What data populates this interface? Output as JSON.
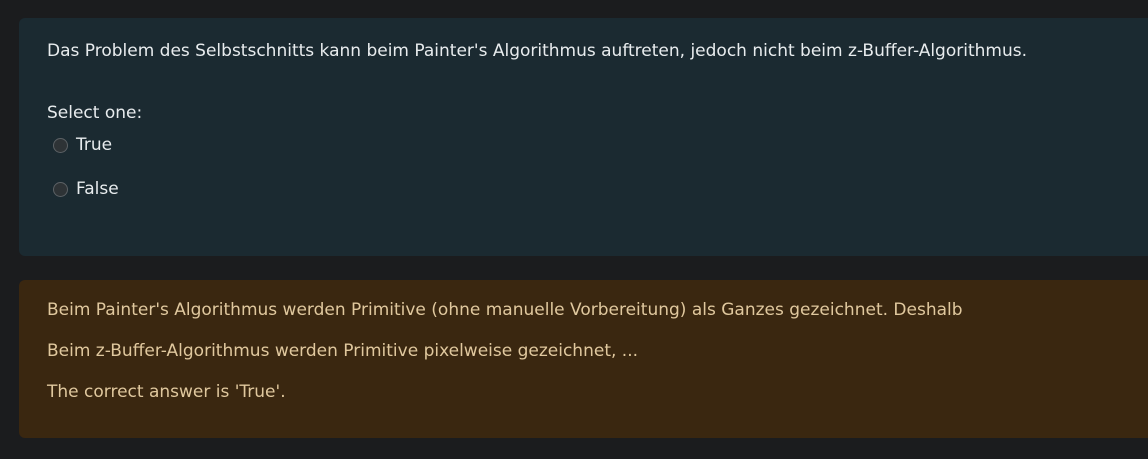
{
  "question": {
    "text": "Das Problem des Selbstschnitts kann beim Painter's Algorithmus auftreten, jedoch nicht beim z-Buffer-Algorithmus.",
    "prompt": "Select one:",
    "options": [
      {
        "label": "True",
        "selected": false
      },
      {
        "label": "False",
        "selected": false
      }
    ]
  },
  "feedback": {
    "line1": "Beim Painter's Algorithmus werden Primitive (ohne manuelle Vorbereitung) als Ganzes gezeichnet. Deshalb",
    "line2": "Beim z-Buffer-Algorithmus werden Primitive pixelweise gezeichnet, ...",
    "correct_answer": "The correct answer is 'True'."
  },
  "colors": {
    "page_background": "#1b1c1e",
    "question_background": "#1b2a31",
    "feedback_background": "#3a2710",
    "feedback_text": "#e0c89e"
  }
}
